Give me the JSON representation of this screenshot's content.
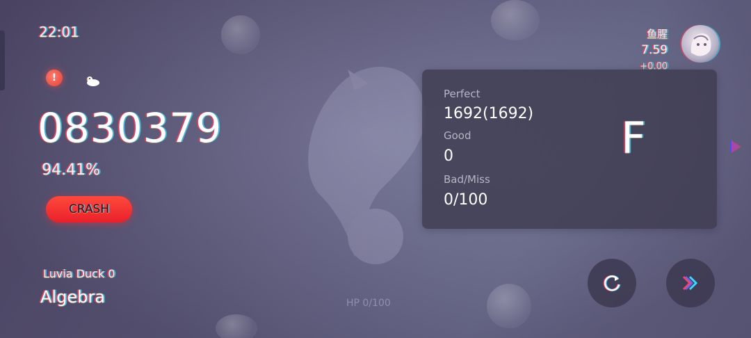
{
  "status": {
    "time": "22:01"
  },
  "result": {
    "score": "0830379",
    "accuracy": "94.41%",
    "crash_label": "CRASH"
  },
  "song": {
    "artist": "Luvia Duck 0",
    "title": "Algebra"
  },
  "hud": {
    "hp_text": "HP  0/100"
  },
  "player": {
    "name": "鱼腥",
    "rks": "7.59",
    "rks_delta": "+0.00"
  },
  "judgement": {
    "perfect_label": "Perfect",
    "perfect_value": "1692(1692)",
    "good_label": "Good",
    "good_value": "0",
    "badmiss_label": "Bad/Miss",
    "badmiss_value": "0/100",
    "grade": "F"
  },
  "colors": {
    "crash": "#ff3a36",
    "warning": "#e2403a",
    "panel": "#3e3c50"
  },
  "icons": {
    "warning": "exclamation-circle-icon",
    "duck": "duck-icon",
    "retry": "retry-icon",
    "continue": "double-chevron-right-icon",
    "next": "play-triangle-icon"
  }
}
